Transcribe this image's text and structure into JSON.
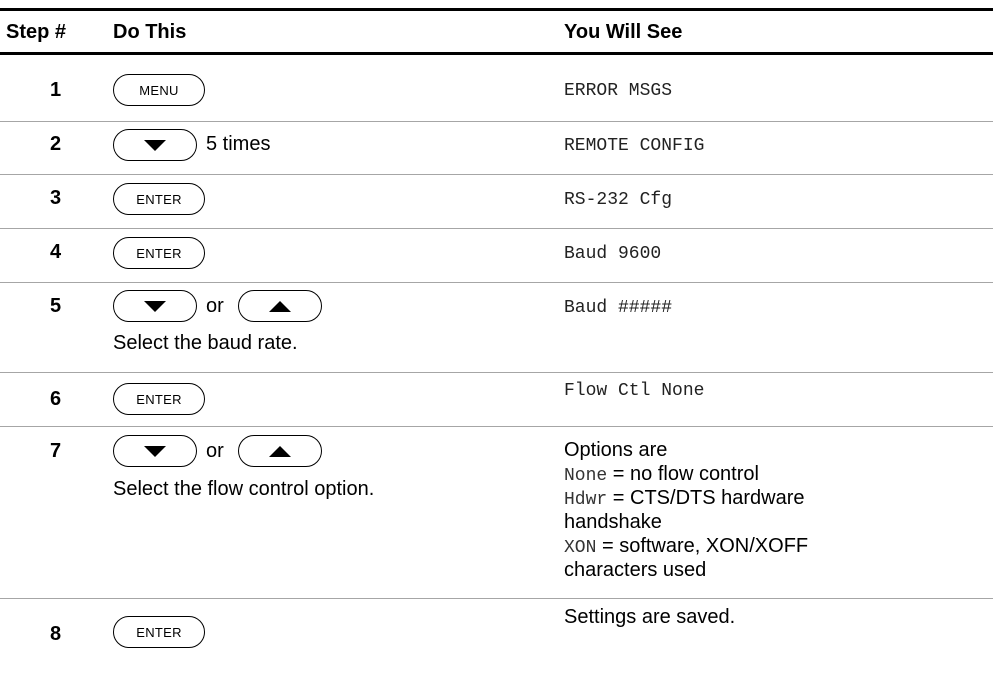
{
  "headers": {
    "step": "Step #",
    "do_this": "Do This",
    "you_will_see": "You Will See"
  },
  "steps": [
    {
      "num": "1",
      "key": "MENU",
      "see": "ERROR MSGS"
    },
    {
      "num": "2",
      "key": "down-arrow",
      "times": "5 times",
      "see": "REMOTE CONFIG"
    },
    {
      "num": "3",
      "key": "ENTER",
      "see": "RS-232 Cfg"
    },
    {
      "num": "4",
      "key": "ENTER",
      "see": "Baud 9600"
    },
    {
      "num": "5",
      "or": "or",
      "instruction": "Select the baud rate.",
      "see": "Baud #####"
    },
    {
      "num": "6",
      "key": "ENTER",
      "see": "Flow Ctl None"
    },
    {
      "num": "7",
      "or": "or",
      "instruction": "Select the flow control option.",
      "options_title": "Options are",
      "options": [
        {
          "code": "None",
          "desc": " = no flow control"
        },
        {
          "code": "Hdwr",
          "desc": " = CTS/DTS hardware"
        },
        {
          "desc_cont": "handshake"
        },
        {
          "code": "XON",
          "desc": " = software, XON/XOFF"
        },
        {
          "desc_cont": "characters used"
        }
      ]
    },
    {
      "num": "8",
      "key": "ENTER",
      "see": "Settings are saved."
    }
  ]
}
